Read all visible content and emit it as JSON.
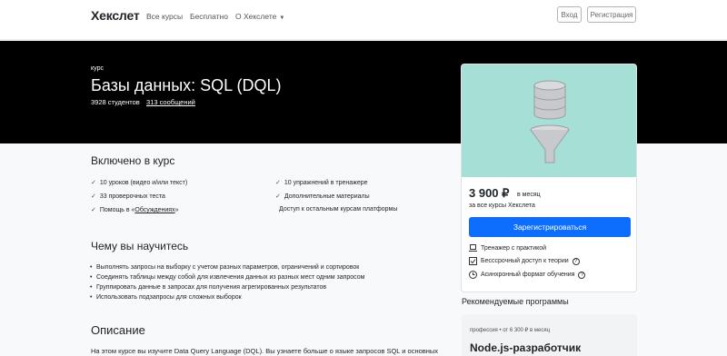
{
  "header": {
    "brand": "Хекслет",
    "nav": [
      "Все курсы",
      "Бесплатно",
      "О Хекслете"
    ],
    "login": "Вход",
    "register": "Регистрация"
  },
  "hero": {
    "kicker": "курс",
    "title": "Базы данных: SQL (DQL)",
    "students": "3928 студентов",
    "messages": "313 сообщений"
  },
  "included": {
    "title": "Включено в курс",
    "left": [
      {
        "pre": "10 уроков (видео и/или текст)",
        "link": "",
        "post": ""
      },
      {
        "pre": "33 проверочных теста",
        "link": "",
        "post": ""
      },
      {
        "pre": "Помощь в «",
        "link": "Обсуждениях",
        "post": "»"
      }
    ],
    "right": [
      "10 упражнений в тренажере",
      "Дополнительные материалы",
      "Доступ к остальным курсам платформы"
    ]
  },
  "learn": {
    "title": "Чему вы научитесь",
    "items": [
      "Выполнять запросы на выборку с учетом разных параметров, ограничений и сортировок",
      "Соединять таблицы между собой для извлечения данных из разных мест одним запросом",
      "Группировать данные в запросах для получения агрегированных результатов",
      "Использовать подзапросы для сложных выборок"
    ]
  },
  "description": {
    "title": "Описание",
    "text": "На этом курсе вы изучите Data Query Language (DQL). Вы узнаете больше о языке запросов SQL и основных"
  },
  "card": {
    "price": "3 900 ₽",
    "price_unit": "в месяц",
    "price_sub": "за все курсы Хекслета",
    "cta": "Зарегистрироваться",
    "features": [
      "Тренажер с практикой",
      "Бесссрочный доступ к теории",
      "Асинхронный формат обучения"
    ],
    "help_mark": "?"
  },
  "recommended": {
    "title": "Рекомендуемые программы",
    "meta": "профессия  •  от 6 300 ₽ в месяц",
    "name": "Node.js-разработчик"
  },
  "colors": {
    "primary": "#0d6efd",
    "hero_bg": "#000000",
    "card_img": "#a6dfd6"
  }
}
